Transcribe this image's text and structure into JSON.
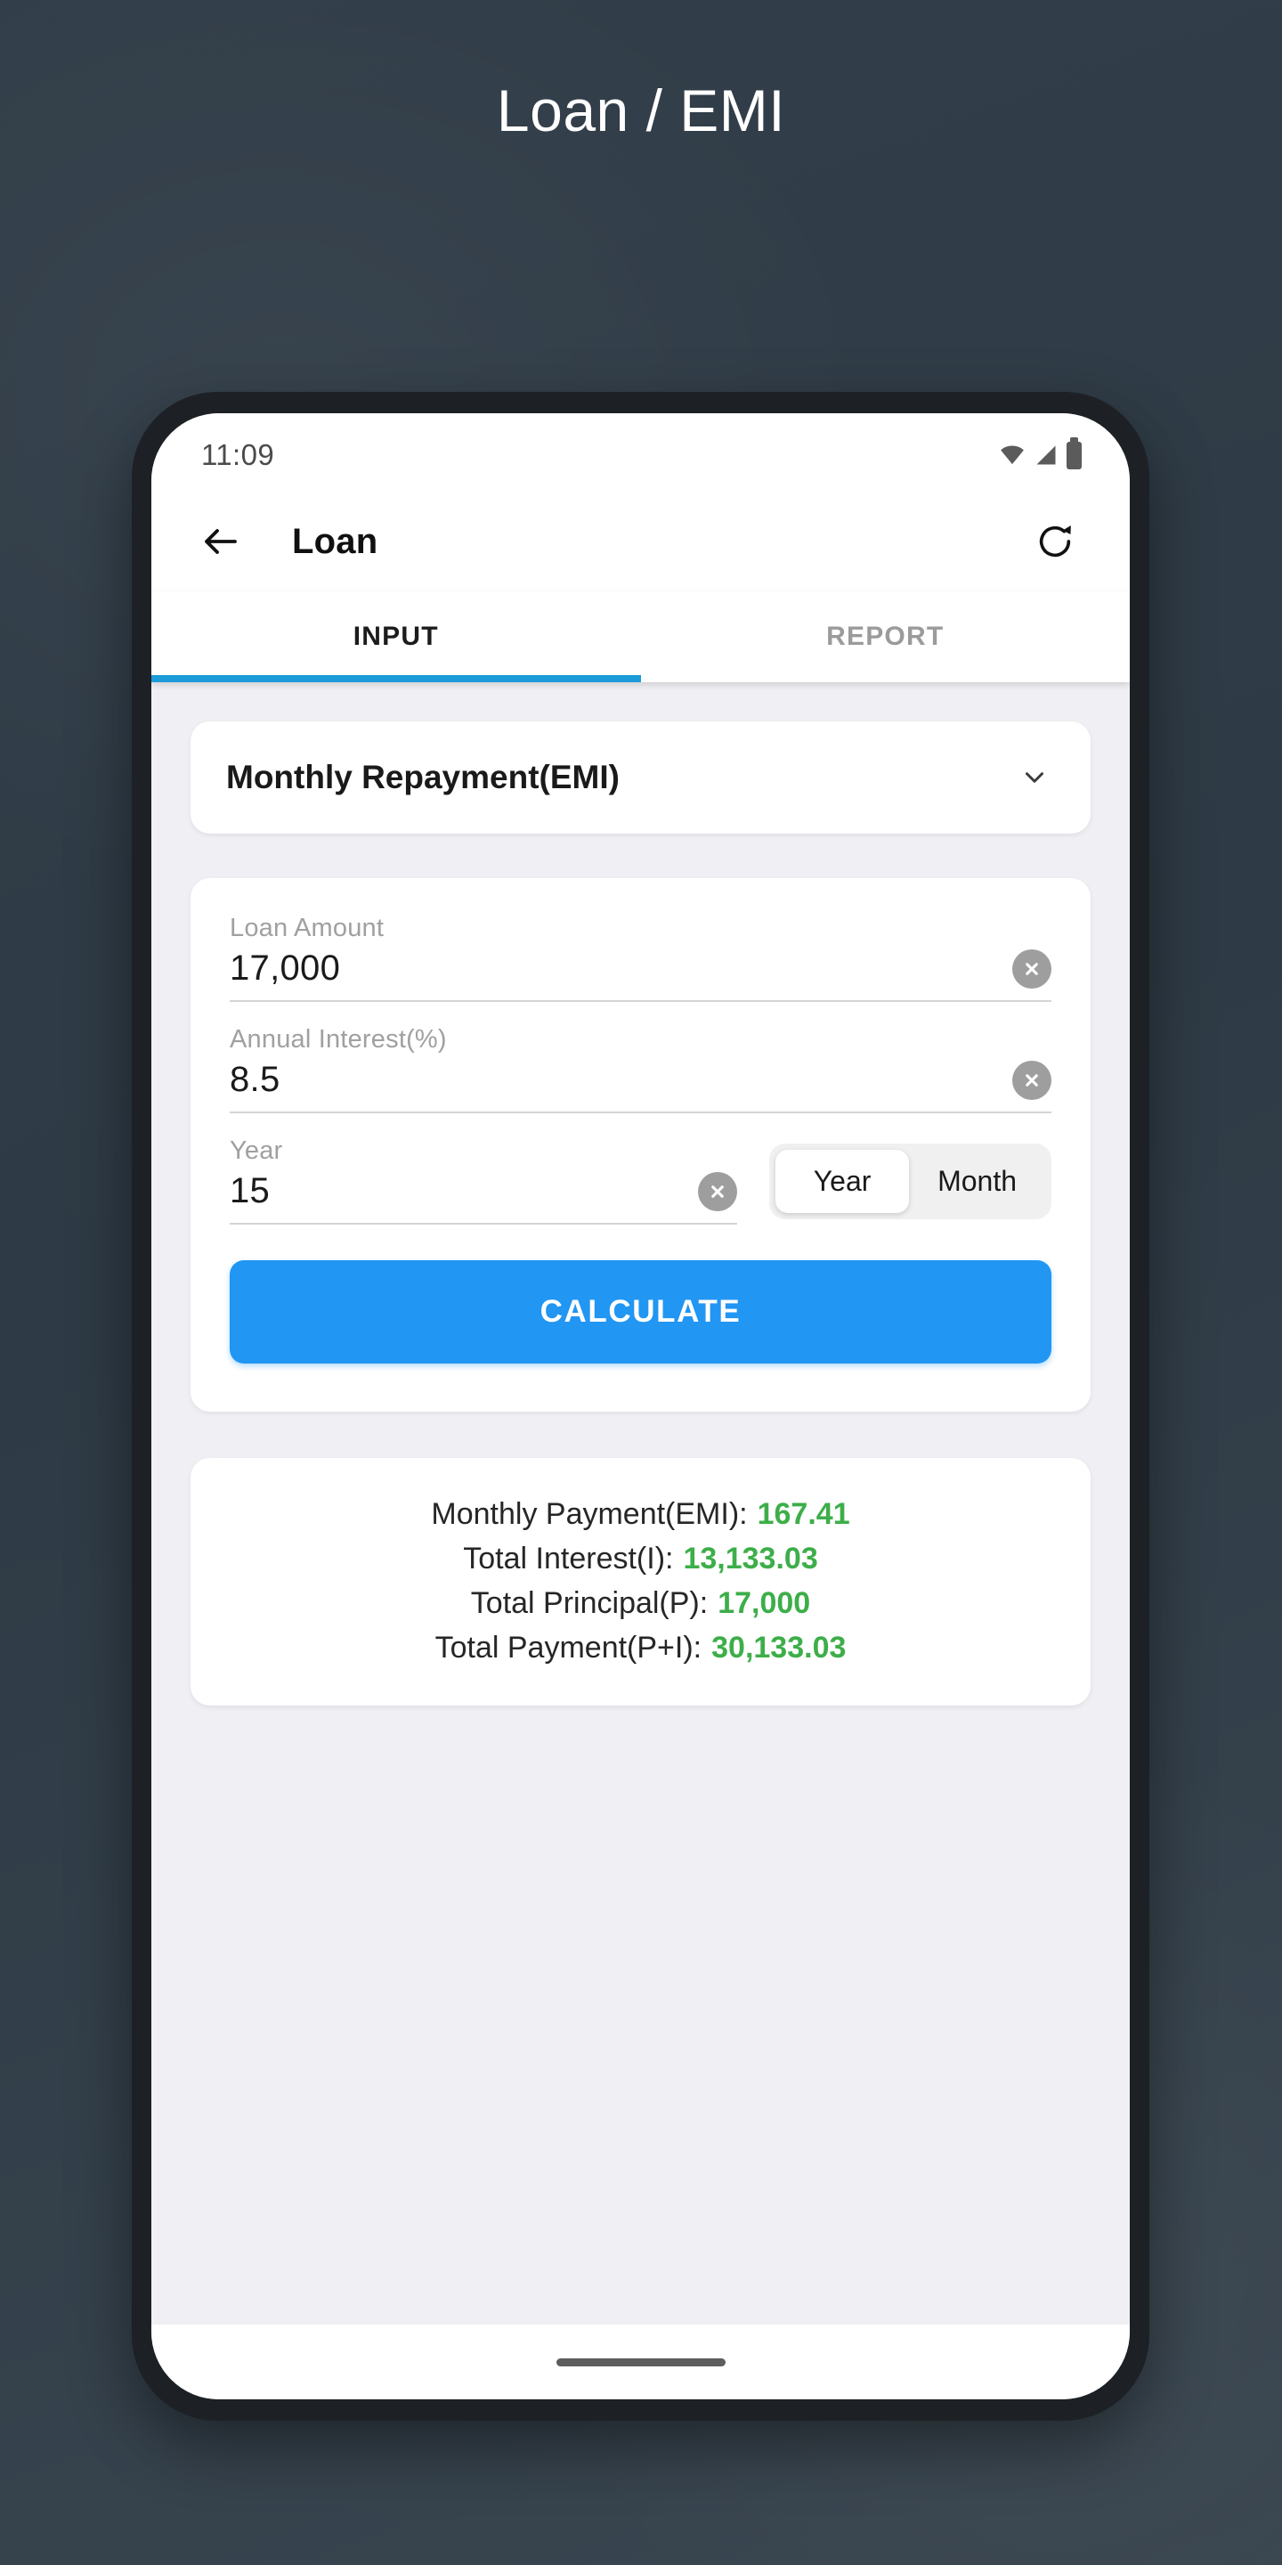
{
  "page": {
    "title": "Loan / EMI"
  },
  "status_bar": {
    "time": "11:09",
    "icons": [
      "wifi-icon",
      "signal-icon",
      "battery-icon"
    ]
  },
  "app_bar": {
    "back_icon": "back-arrow-icon",
    "title": "Loan",
    "refresh_icon": "refresh-icon"
  },
  "tabs": [
    {
      "label": "INPUT",
      "active": true
    },
    {
      "label": "REPORT",
      "active": false
    }
  ],
  "calc_type": {
    "selected": "Monthly Repayment(EMI)",
    "chevron_icon": "chevron-down-icon"
  },
  "fields": [
    {
      "label": "Loan Amount",
      "value": "17,000",
      "clear_icon": "clear-circle-icon"
    },
    {
      "label": "Annual Interest(%)",
      "value": "8.5",
      "clear_icon": "clear-circle-icon"
    },
    {
      "label": "Year",
      "value": "15",
      "clear_icon": "clear-circle-icon"
    }
  ],
  "term_toggle": {
    "options": [
      "Year",
      "Month"
    ],
    "selected": "Year"
  },
  "calculate_button": {
    "label": "CALCULATE"
  },
  "results": [
    {
      "label": "Monthly Payment(EMI):",
      "value": "167.41"
    },
    {
      "label": "Total Interest(I):",
      "value": "13,133.03"
    },
    {
      "label": "Total Principal(P):",
      "value": "17,000"
    },
    {
      "label": "Total Payment(P+I):",
      "value": "30,133.03"
    }
  ],
  "colors": {
    "background": "#323d48",
    "accent_blue": "#2196f3",
    "tab_indicator": "#1b9bd8",
    "result_green": "#3dae49",
    "card": "#ffffff",
    "content_bg": "#f0f0f4",
    "bezel": "#1d2125"
  },
  "home_indicator": "home-indicator"
}
